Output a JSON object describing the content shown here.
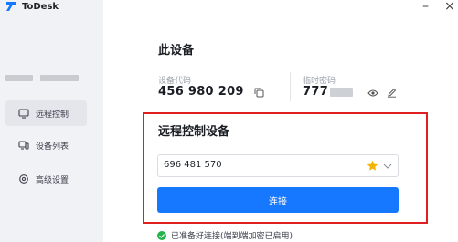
{
  "app": {
    "name": "ToDesk"
  },
  "window": {
    "minimize": "–",
    "close": "×"
  },
  "sidebar": {
    "items": [
      {
        "label": "远程控制",
        "icon": "remote-control-icon",
        "active": true
      },
      {
        "label": "设备列表",
        "icon": "device-list-icon",
        "active": false
      },
      {
        "label": "高级设置",
        "icon": "gear-icon",
        "active": false
      }
    ]
  },
  "this_device": {
    "title": "此设备",
    "device_code_label": "设备代码",
    "device_code": "456 980 209",
    "temp_password_label": "临时密码",
    "temp_password_visible": "777"
  },
  "remote": {
    "title": "远程控制设备",
    "input_value": "696 481 570",
    "connect_label": "连接"
  },
  "status": {
    "text": "已准备好连接(端到端加密已启用)"
  },
  "colors": {
    "accent": "#1677ff",
    "highlight_border": "#e02020",
    "star": "#f5b400",
    "ok": "#22b34a"
  }
}
